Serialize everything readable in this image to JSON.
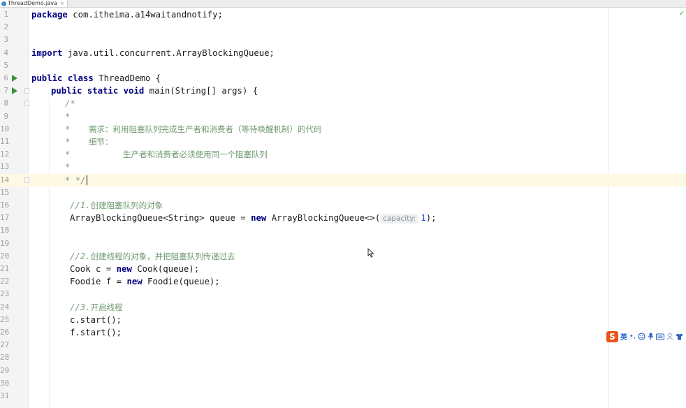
{
  "tab": {
    "label": "ThreadDemo.java",
    "close": "×"
  },
  "gutter": {
    "line_numbers": [
      "1",
      "2",
      "3",
      "4",
      "5",
      "6",
      "7",
      "8",
      "9",
      "10",
      "11",
      "12",
      "13",
      "14",
      "15",
      "16",
      "17",
      "18",
      "19",
      "20",
      "21",
      "22",
      "23",
      "24",
      "25",
      "26",
      "27",
      "28",
      "29",
      "30",
      "31"
    ]
  },
  "code": {
    "l1_kw": "package",
    "l1_rest": " com.itheima.a14waitandnotify;",
    "l4_kw": "import",
    "l4_rest": " java.util.concurrent.ArrayBlockingQueue;",
    "l6_kw": "public class",
    "l6_rest": " ThreadDemo {",
    "l7_kw": "public static void",
    "l7_rest": " main(String[] args) {",
    "l8": "/*",
    "l9": "*",
    "l10_star": "*",
    "l10_text": "需求：利用阻塞队列完成生产者和消费者（等待唤醒机制）的代码",
    "l11_star": "*",
    "l11_text": "细节：",
    "l12_star": "*",
    "l12_text": "生产者和消费者必须使用同一个阻塞队列",
    "l13": "*",
    "l14": "* */",
    "l16_prefix": "//1.",
    "l16_text": "创建阻塞队列的对象",
    "l17_a": "ArrayBlockingQueue<String> queue = ",
    "l17_new": "new",
    "l17_b": " ArrayBlockingQueue<>(",
    "l17_hint": "capacity:",
    "l17_num": "1",
    "l17_c": ");",
    "l20_prefix": "//2.",
    "l20_text": "创建线程的对象，并把阻塞队列传递过去",
    "l21_a": "Cook c = ",
    "l21_new": "new",
    "l21_b": " Cook(queue);",
    "l22_a": "Foodie f = ",
    "l22_new": "new",
    "l22_b": " Foodie(queue);",
    "l24_prefix": "//3.",
    "l24_text": "开启线程",
    "l25": "c.start();",
    "l26": "f.start();"
  },
  "ime": {
    "logo": "S",
    "lang": "英",
    "punct": "•,",
    "icons": [
      "smile-icon",
      "mic-icon",
      "keyboard-icon",
      "user-icon",
      "shirt-icon"
    ]
  },
  "status": {
    "check": "✓"
  },
  "colors": {
    "keyword": "#000080",
    "comment": "#7f9d7f",
    "number": "#1750eb",
    "run_icon": "#389438",
    "current_line": "#fdf9e5",
    "ime_logo": "#e8541b"
  }
}
